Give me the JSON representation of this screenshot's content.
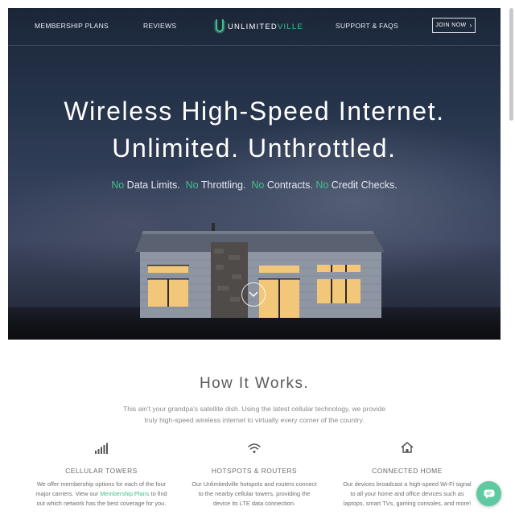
{
  "nav": {
    "links": [
      "MEMBERSHIP PLANS",
      "REVIEWS",
      "SUPPORT & FAQS"
    ],
    "logo_main": "UNLIMITED",
    "logo_accent": "VILLE",
    "join_label": "JOIN NOW"
  },
  "hero": {
    "headline_1": "Wireless High-Speed Internet.",
    "headline_2": "Unlimited. Unthrottled.",
    "tagline": [
      {
        "no": "No",
        "text": "Data Limits."
      },
      {
        "no": "No",
        "text": "Throttling."
      },
      {
        "no": "No",
        "text": "Contracts."
      },
      {
        "no": "No",
        "text": "Credit Checks."
      }
    ]
  },
  "how": {
    "title": "How It Works.",
    "desc_1": "This ain't your grandpa's satellite dish. Using the latest cellular technology, we provide",
    "desc_2": "truly high-speed wireless internet to virtually every corner of the country.",
    "features": [
      {
        "icon": "signal-bars-icon",
        "title": "CELLULAR TOWERS",
        "line_1": "We offer membership options for each of the four",
        "line_2_pre": "major carriers. View our ",
        "line_2_link": "Membership Plans",
        "line_2_post": " to find",
        "line_3": "out which network has the best coverage for you."
      },
      {
        "icon": "wifi-icon",
        "title": "HOTSPOTS & ROUTERS",
        "line_1": "Our Unlimitedville hotspots and routers connect",
        "line_2": "to the nearby cellular towers, providing the",
        "line_3": "device its LTE data connection."
      },
      {
        "icon": "home-icon",
        "title": "CONNECTED HOME",
        "line_1": "Our devices broadcast a high-speed Wi-Fi signal",
        "line_2": "to all your home and office devices such as",
        "line_3": "laptops, smart TVs, gaming consoles, and more!"
      }
    ]
  },
  "colors": {
    "accent": "#3fc08b",
    "chat": "#5fc9a0"
  }
}
